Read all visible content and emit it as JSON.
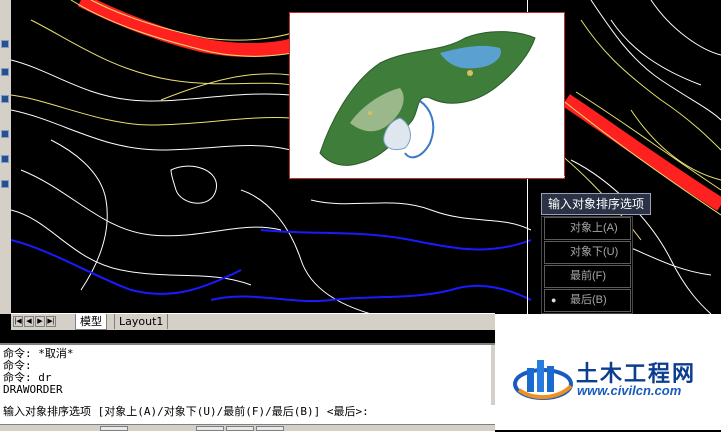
{
  "left_toolbar": {
    "icons": [
      "draw-tool-icon",
      "modify-tool-icon",
      "layer-tool-icon",
      "zoom-tool-icon",
      "pan-tool-icon",
      "properties-tool-icon"
    ]
  },
  "prompt_tooltip": {
    "text": "输入对象排序选项"
  },
  "draworder_menu": {
    "items": [
      {
        "label": "对象上(A)",
        "selected": false
      },
      {
        "label": "对象下(U)",
        "selected": false
      },
      {
        "label": "最前(F)",
        "selected": false
      },
      {
        "label": "最后(B)",
        "selected": true
      }
    ],
    "bullet": "●"
  },
  "layout_tabs": {
    "nav_buttons": [
      "|◀",
      "◀",
      "▶",
      "▶|"
    ],
    "tabs": [
      {
        "label": "模型"
      },
      {
        "label": "Layout1"
      }
    ]
  },
  "command_history": {
    "lines": [
      "命令: *取消*",
      "命令:",
      "命令: dr",
      "DRAWORDER"
    ],
    "current_prompt": "输入对象排序选项 [对象上(A)/对象下(U)/最前(F)/最后(B)] <最后>:"
  },
  "watermark": {
    "name": "土木工程网",
    "url": "www.civilcn.com"
  },
  "colors": {
    "canvas_bg": "#000000",
    "contour_white": "#ffffff",
    "contour_yellow": "#e8e070",
    "road_red": "#ff2020",
    "river_blue": "#1a1aff",
    "logo_blue": "#0b3e8f"
  }
}
